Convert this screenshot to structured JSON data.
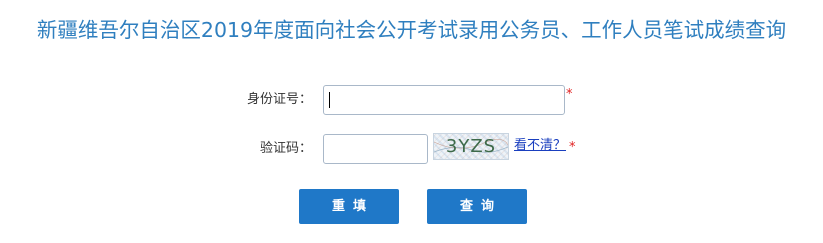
{
  "header": {
    "title": "新疆维吾尔自治区2019年度面向社会公开考试录用公务员、工作人员笔试成绩查询"
  },
  "form": {
    "id_label": "身份证号：",
    "id_value": "",
    "id_required_mark": "*",
    "captcha_label": "验证码：",
    "captcha_value": "",
    "captcha_image_text": "3YZS",
    "captcha_refresh_link": "看不清？",
    "captcha_required_mark": "*"
  },
  "buttons": {
    "reset_label": "重填",
    "query_label": "查询"
  },
  "colors": {
    "title": "#2f7fbf",
    "button_bg": "#1f78c8",
    "required_mark": "#e02020",
    "link": "#1a3fbf"
  }
}
